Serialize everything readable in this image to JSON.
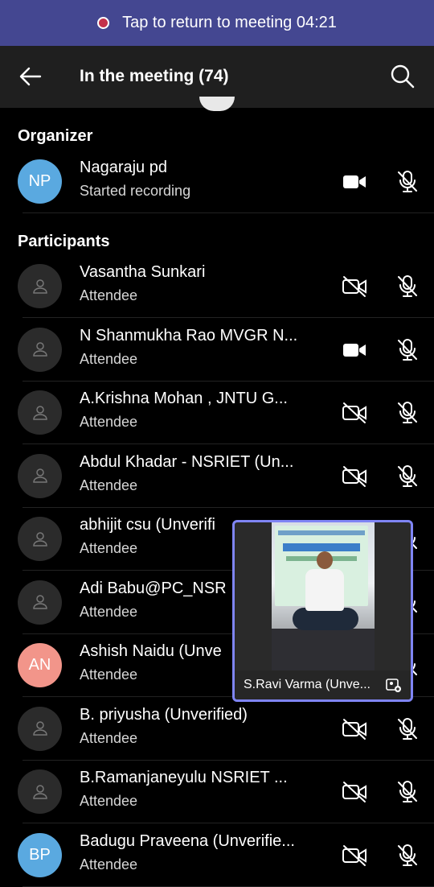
{
  "banner": {
    "text": "Tap to return to meeting 04:21"
  },
  "header": {
    "title": "In the meeting (74)"
  },
  "sections": {
    "organizer": "Organizer",
    "participants": "Participants"
  },
  "organizer": {
    "initials": "NP",
    "name": "Nagaraju pd",
    "role": "Started recording",
    "avatar_color": "#5aa9e0",
    "camera": "on"
  },
  "participants": [
    {
      "name": "Vasantha Sunkari",
      "role": "Attendee",
      "camera": "off"
    },
    {
      "name": "N Shanmukha Rao MVGR N...",
      "role": "Attendee",
      "camera": "on"
    },
    {
      "name": "A.Krishna Mohan , JNTU G...",
      "role": "Attendee",
      "camera": "off"
    },
    {
      "name": "Abdul Khadar - NSRIET (Un...",
      "role": "Attendee",
      "camera": "off"
    },
    {
      "name": "abhijit csu (Unverifi",
      "role": "Attendee",
      "camera": "off"
    },
    {
      "name": "Adi Babu@PC_NSR",
      "role": "Attendee",
      "camera": "off"
    },
    {
      "name": "Ashish Naidu (Unve",
      "role": "Attendee",
      "initials": "AN",
      "avatar_color": "#f2958a",
      "camera": "off"
    },
    {
      "name": "B. priyusha  (Unverified)",
      "role": "Attendee",
      "camera": "off"
    },
    {
      "name": "B.Ramanjaneyulu  NSRIET ...",
      "role": "Attendee",
      "camera": "off"
    },
    {
      "name": "Badugu Praveena (Unverifie...",
      "role": "Attendee",
      "initials": "BP",
      "avatar_color": "#5aa9e0",
      "camera": "off"
    }
  ],
  "pip": {
    "caption": "S.Ravi Varma (Unve..."
  },
  "colors": {
    "banner": "#444791",
    "header": "#1f1f1f",
    "pip_border": "#7f85f5",
    "record_dot": "#c4314b"
  }
}
